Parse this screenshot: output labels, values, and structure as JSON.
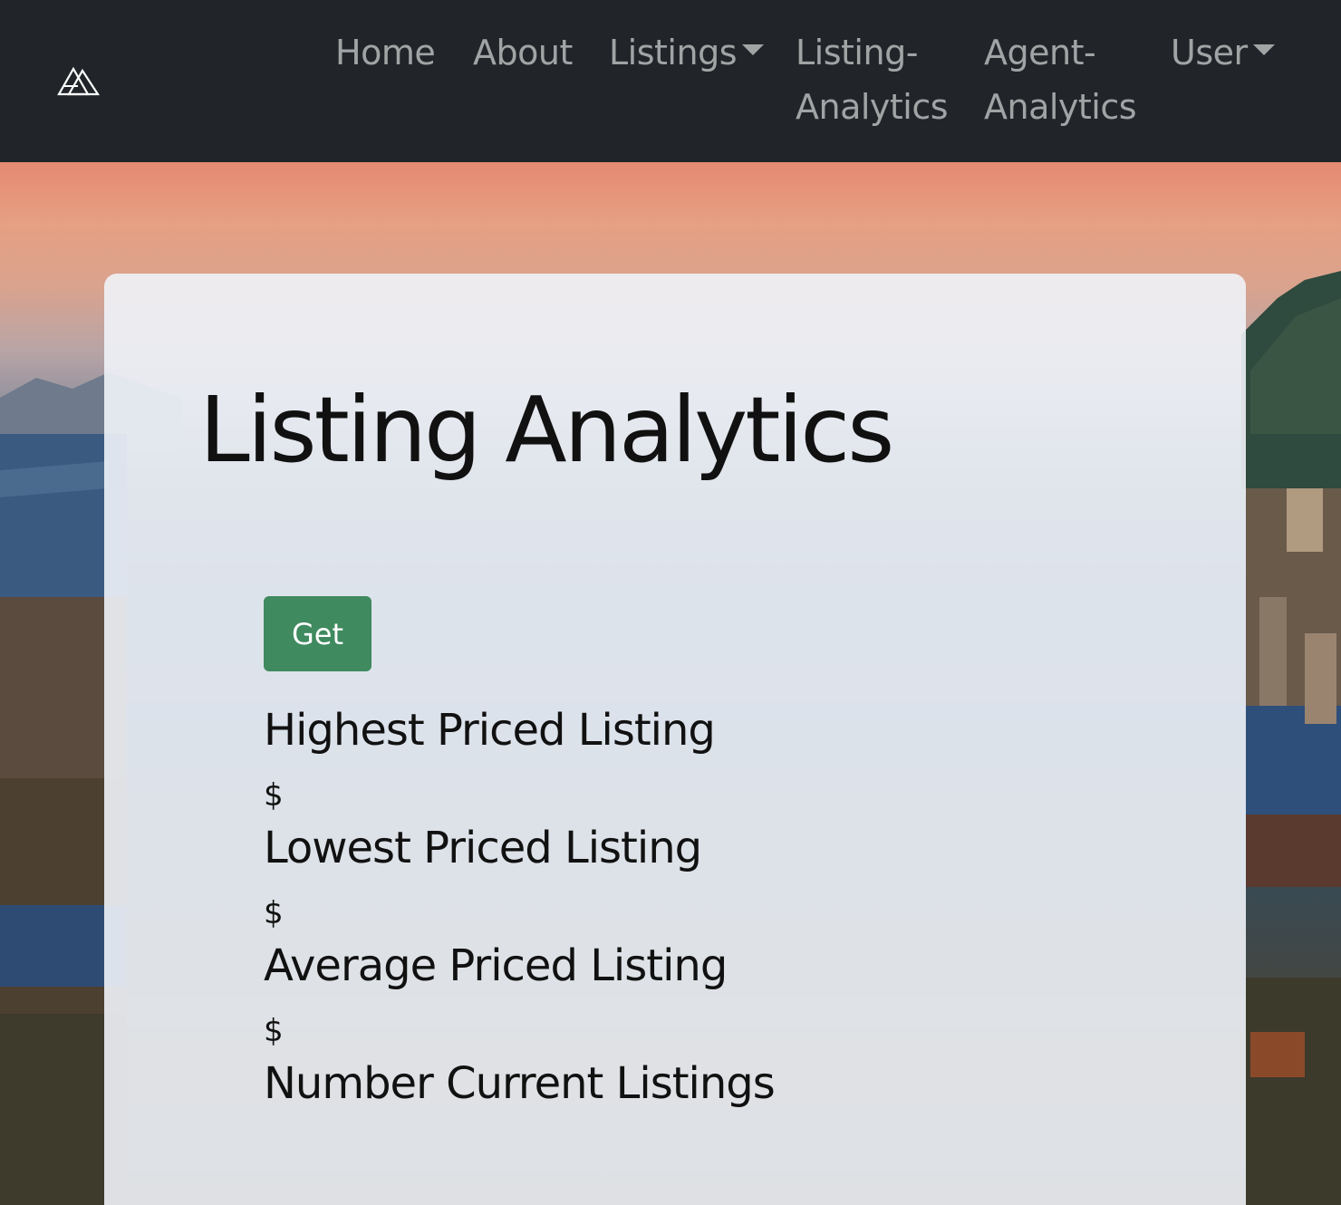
{
  "navbar": {
    "brand": "brand-logo",
    "items": [
      {
        "line1": "Home",
        "line2": ""
      },
      {
        "line1": "About",
        "line2": ""
      },
      {
        "line1": "Listings",
        "line2": ""
      },
      {
        "line1": "Listing-",
        "line2": "Analytics"
      },
      {
        "line1": "Agent-",
        "line2": "Analytics"
      },
      {
        "line1": "User",
        "line2": ""
      }
    ]
  },
  "main": {
    "title": "Listing Analytics",
    "get_button": "Get",
    "stats": [
      {
        "label": "Highest Priced Listing",
        "value": "$"
      },
      {
        "label": "Lowest Priced Listing",
        "value": "$"
      },
      {
        "label": "Average Priced Listing",
        "value": "$"
      },
      {
        "label": "Number Current Listings",
        "value": ""
      }
    ]
  },
  "colors": {
    "navbar_bg": "#212529",
    "button_bg": "#3f8a5f",
    "card_bg": "#f0f3f8"
  }
}
